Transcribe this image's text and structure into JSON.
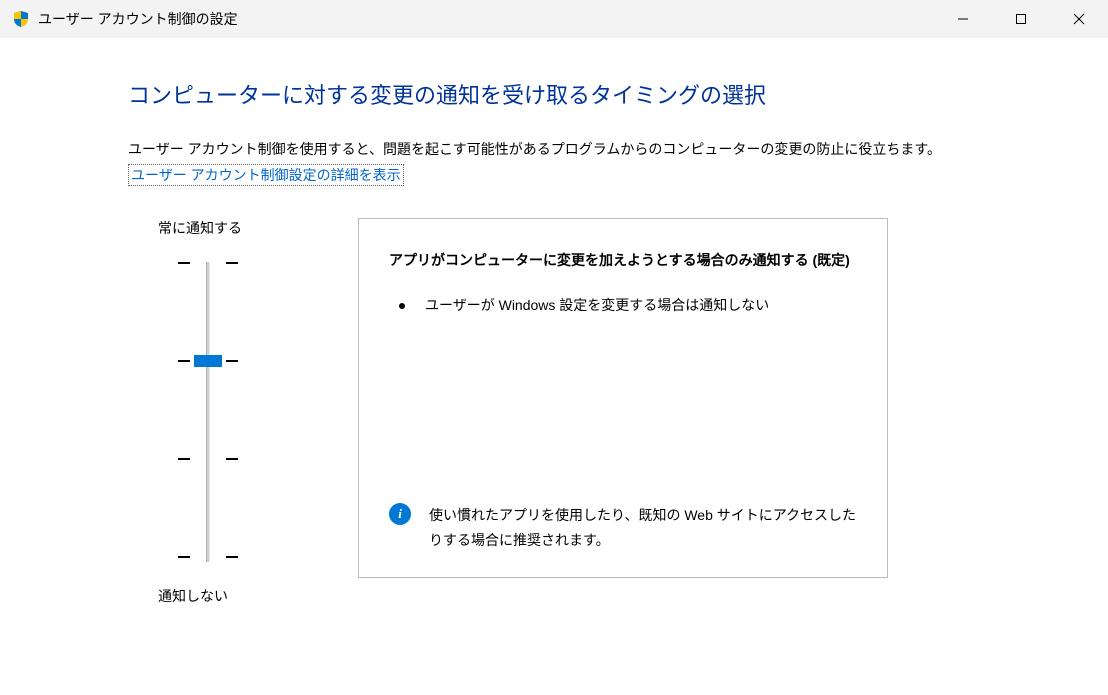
{
  "window": {
    "title": "ユーザー アカウント制御の設定"
  },
  "page": {
    "heading": "コンピューターに対する変更の通知を受け取るタイミングの選択",
    "description": "ユーザー アカウント制御を使用すると、問題を起こす可能性があるプログラムからのコンピューターの変更の防止に役立ちます。",
    "link": "ユーザー アカウント制御設定の詳細を表示"
  },
  "slider": {
    "top_label": "常に通知する",
    "bottom_label": "通知しない",
    "levels": 4,
    "current_level": 2
  },
  "info": {
    "title": "アプリがコンピューターに変更を加えようとする場合のみ通知する (既定)",
    "bullet": "ユーザーが Windows 設定を変更する場合は通知しない",
    "recommendation": "使い慣れたアプリを使用したり、既知の Web サイトにアクセスしたりする場合に推奨されます。"
  }
}
